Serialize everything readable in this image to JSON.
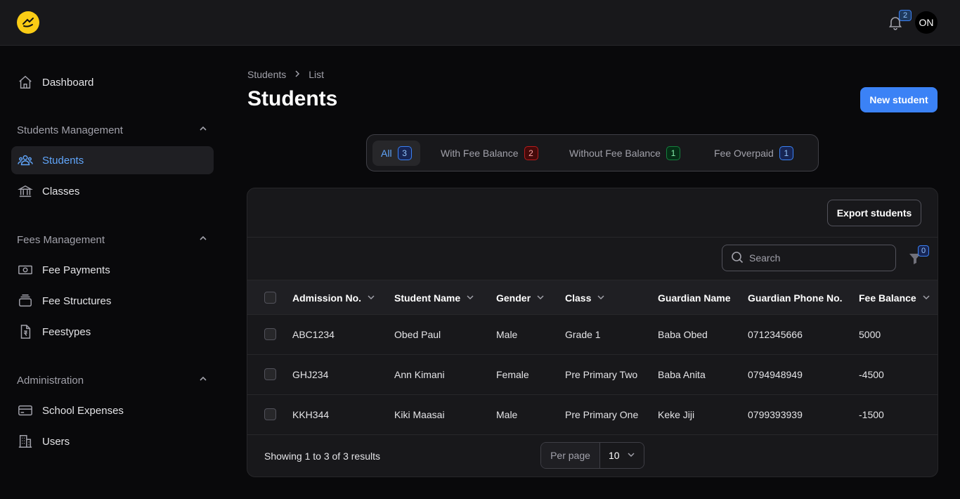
{
  "topbar": {
    "notification_count": "2",
    "avatar_initials": "ON"
  },
  "sidebar": {
    "dashboard": "Dashboard",
    "groups": [
      {
        "title": "Students Management",
        "items": [
          "Students",
          "Classes"
        ]
      },
      {
        "title": "Fees Management",
        "items": [
          "Fee Payments",
          "Fee Structures",
          "Feestypes"
        ]
      },
      {
        "title": "Administration",
        "items": [
          "School Expenses",
          "Users"
        ]
      }
    ],
    "active_item": "Students"
  },
  "breadcrumb": {
    "parent": "Students",
    "current": "List"
  },
  "page": {
    "title": "Students",
    "new_button": "New student"
  },
  "tabs": [
    {
      "label": "All",
      "count": "3"
    },
    {
      "label": "With Fee Balance",
      "count": "2"
    },
    {
      "label": "Without Fee Balance",
      "count": "1"
    },
    {
      "label": "Fee Overpaid",
      "count": "1"
    }
  ],
  "table": {
    "export_button": "Export students",
    "search_placeholder": "Search",
    "filter_count": "0",
    "columns": [
      "Admission No.",
      "Student Name",
      "Gender",
      "Class",
      "Guardian Name",
      "Guardian Phone No.",
      "Fee Balance"
    ],
    "rows": [
      [
        "ABC1234",
        "Obed Paul",
        "Male",
        "Grade 1",
        "Baba Obed",
        "0712345666",
        "5000"
      ],
      [
        "GHJ234",
        "Ann Kimani",
        "Female",
        "Pre Primary Two",
        "Baba Anita",
        "0794948949",
        "-4500"
      ],
      [
        "KKH344",
        "Kiki Maasai",
        "Male",
        "Pre Primary One",
        "Keke Jiji",
        "0799393939",
        "-1500"
      ]
    ],
    "footer_text": "Showing 1 to 3 of 3 results",
    "per_page_label": "Per page",
    "per_page_value": "10"
  },
  "colors": {
    "accent": "#3b82f6",
    "brand": "#facc15"
  }
}
